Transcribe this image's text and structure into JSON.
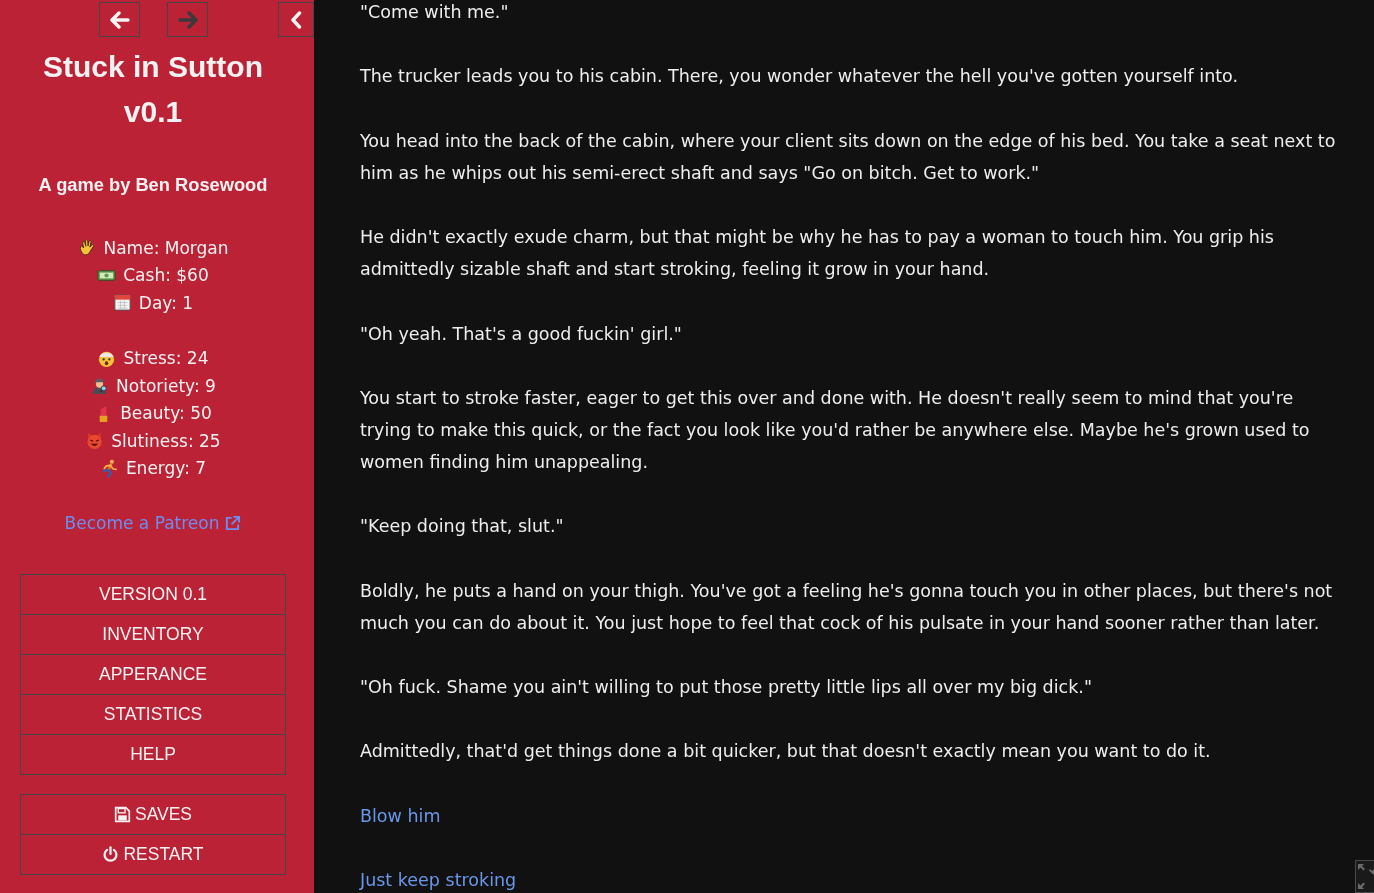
{
  "sidebar": {
    "history": {
      "back": {
        "disabled": false
      },
      "forward": {
        "disabled": true
      }
    },
    "title": "Stuck in Sutton v0.1",
    "subtitle": "A game by Ben Rosewood",
    "stat_groups": [
      {
        "stats": [
          {
            "text": "Name: Morgan"
          },
          {
            "text": "Cash: $60"
          },
          {
            "text": "Day: 1"
          }
        ]
      },
      {
        "stats": [
          {
            "text": "Stress: 24"
          },
          {
            "text": "Notoriety: 9"
          },
          {
            "text": "Beauty: 50"
          },
          {
            "text": "Slutiness: 25"
          },
          {
            "text": "Energy: 7"
          }
        ]
      }
    ],
    "patreon_link": "Become a Patreon",
    "menu": [
      {
        "label": "VERSION 0.1"
      },
      {
        "label": "INVENTORY"
      },
      {
        "label": "APPERANCE"
      },
      {
        "label": "STATISTICS"
      },
      {
        "label": "HELP"
      }
    ],
    "actions": [
      {
        "label": "SAVES"
      },
      {
        "label": "RESTART"
      }
    ]
  },
  "passage": [
    {
      "kind": "text",
      "text": "\"Come with me.\""
    },
    {
      "kind": "text",
      "text": "The trucker leads you to his cabin. There, you wonder whatever the hell you've gotten yourself into."
    },
    {
      "kind": "text",
      "text": "You head into the back of the cabin, where your client sits down on the edge of his bed. You take a seat next to him as he whips out his semi-erect shaft and says \"Go on bitch. Get to work.\""
    },
    {
      "kind": "text",
      "text": "He didn't exactly exude charm, but that might be why he has to pay a woman to touch him. You grip his admittedly sizable shaft and start stroking, feeling it grow in your hand."
    },
    {
      "kind": "text",
      "text": "\"Oh yeah. That's a good fuckin' girl.\""
    },
    {
      "kind": "text",
      "text": "You start to stroke faster, eager to get this over and done with. He doesn't really seem to mind that you're trying to make this quick, or the fact you look like you'd rather be anywhere else. Maybe he's grown used to women finding him unappealing."
    },
    {
      "kind": "text",
      "text": "\"Keep doing that, slut.\""
    },
    {
      "kind": "text",
      "text": "Boldly, he puts a hand on your thigh. You've got a feeling he's gonna touch you in other places, but there's not much you can do about it. You just hope to feel that cock of his pulsate in your hand sooner rather than later."
    },
    {
      "kind": "text",
      "text": "\"Oh fuck. Shame you ain't willing to put those pretty little lips all over my big dick.\""
    },
    {
      "kind": "text",
      "text": "Admittedly, that'd get things done a bit quicker, but that doesn't exactly mean you want to do it."
    },
    {
      "kind": "link",
      "text": "Blow him"
    },
    {
      "kind": "link",
      "text": "Just keep stroking"
    }
  ]
}
